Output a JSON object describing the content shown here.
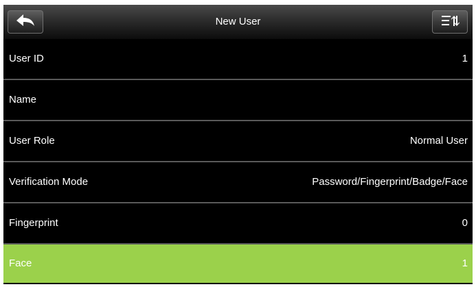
{
  "header": {
    "title": "New User",
    "back_icon": "back-arrow-icon",
    "sort_icon": "sort-list-icon"
  },
  "rows": [
    {
      "label": "User ID",
      "value": "1"
    },
    {
      "label": "Name",
      "value": ""
    },
    {
      "label": "User Role",
      "value": "Normal User"
    },
    {
      "label": "Verification Mode",
      "value": "Password/Fingerprint/Badge/Face"
    },
    {
      "label": "Fingerprint",
      "value": "0"
    },
    {
      "label": "Face",
      "value": "1"
    }
  ],
  "colors": {
    "background": "#000000",
    "selected_row": "#9bd14b",
    "text": "#ffffff",
    "divider": "#5a5a5a"
  }
}
